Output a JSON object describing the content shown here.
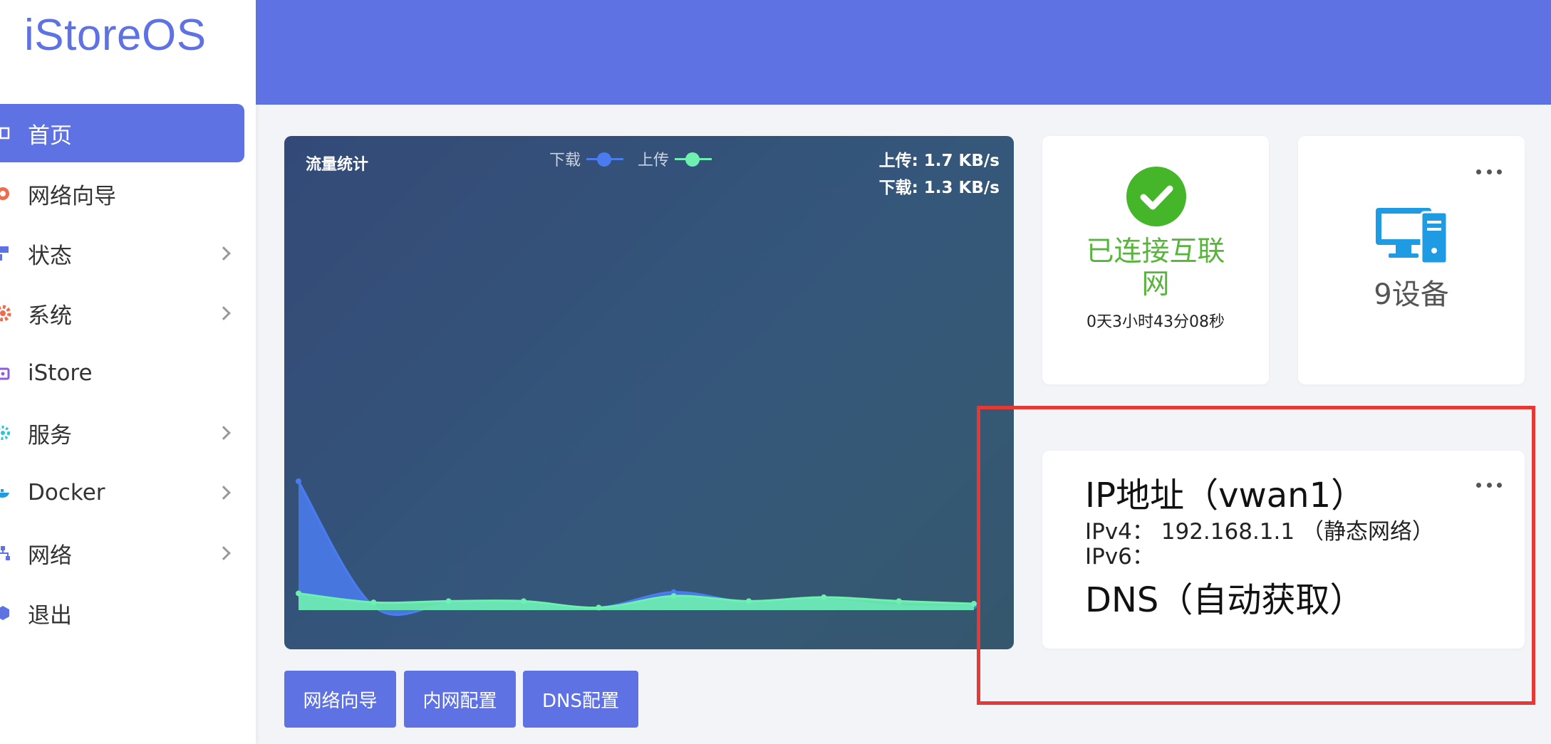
{
  "app": {
    "logo": "iStoreOS"
  },
  "sidebar": {
    "items": [
      {
        "label": "首页",
        "icon": "home-icon",
        "active": true,
        "has_submenu": false
      },
      {
        "label": "网络向导",
        "icon": "network-wizard-icon",
        "active": false,
        "has_submenu": false
      },
      {
        "label": "状态",
        "icon": "status-icon",
        "active": false,
        "has_submenu": true
      },
      {
        "label": "系统",
        "icon": "gear-icon",
        "active": false,
        "has_submenu": true
      },
      {
        "label": "iStore",
        "icon": "store-icon",
        "active": false,
        "has_submenu": false
      },
      {
        "label": "服务",
        "icon": "services-icon",
        "active": false,
        "has_submenu": true
      },
      {
        "label": "Docker",
        "icon": "docker-icon",
        "active": false,
        "has_submenu": true
      },
      {
        "label": "网络",
        "icon": "network-icon",
        "active": false,
        "has_submenu": true
      },
      {
        "label": "退出",
        "icon": "logout-icon",
        "active": false,
        "has_submenu": false
      }
    ]
  },
  "traffic": {
    "title": "流量统计",
    "legend_download": "下载",
    "legend_upload": "上传",
    "upload_rate": "上传: 1.7 KB/s",
    "download_rate": "下载: 1.3 KB/s"
  },
  "chart_data": {
    "type": "area",
    "title": "流量统计",
    "x": [
      0,
      1,
      2,
      3,
      4,
      5,
      6,
      7,
      8,
      9
    ],
    "series": [
      {
        "name": "下载",
        "color": "#4a7cf0",
        "values": [
          10,
          0.3,
          0.5,
          0.6,
          0.2,
          1.4,
          0.6,
          0.8,
          0.3,
          0.3
        ]
      },
      {
        "name": "上传",
        "color": "#6ef0b0",
        "values": [
          1.3,
          0.6,
          0.7,
          0.7,
          0.2,
          1.1,
          0.7,
          1.0,
          0.7,
          0.5
        ]
      }
    ],
    "ylim": [
      0,
      10
    ],
    "grid": false,
    "legend_position": "top-center"
  },
  "buttons": {
    "network_wizard": "网络向导",
    "lan_config": "内网配置",
    "dns_config": "DNS配置"
  },
  "status": {
    "connected_text": "已连接互联网",
    "uptime": "0天3小时43分08秒",
    "success_color": "#45b52a",
    "devices": "9设备",
    "device_icon_color": "#1e9be3"
  },
  "ip": {
    "title": "IP地址（vwan1）",
    "ipv4": "IPv4：  192.168.1.1 （静态网络）",
    "ipv6": "IPv6：",
    "dns": "DNS（自动获取）"
  },
  "colors": {
    "accent": "#5e72e4",
    "highlight_box": "#e53935"
  }
}
